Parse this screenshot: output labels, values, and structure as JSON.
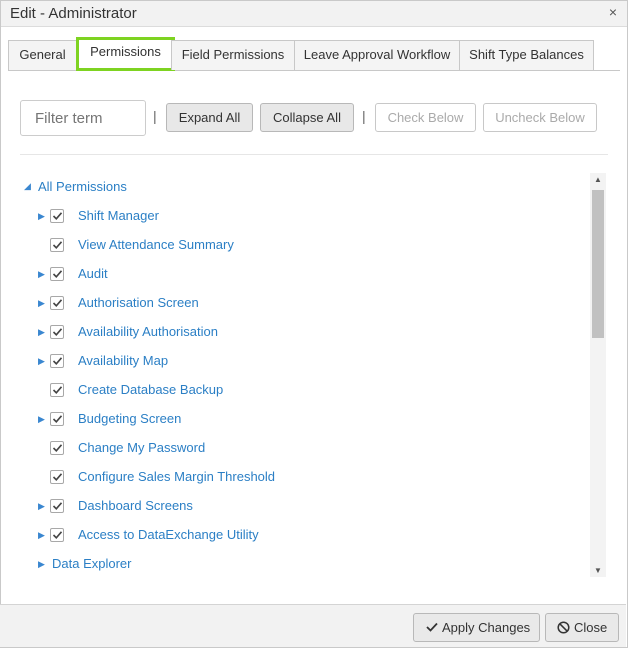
{
  "dialog": {
    "title": "Edit - Administrator",
    "close_symbol": "×"
  },
  "tabs": [
    {
      "label": "General"
    },
    {
      "label": "Permissions"
    },
    {
      "label": "Field Permissions"
    },
    {
      "label": "Leave Approval Workflow"
    },
    {
      "label": "Shift Type Balances"
    }
  ],
  "active_tab": "Permissions",
  "toolbar": {
    "filter_placeholder": "Filter term",
    "separator": "|",
    "expand_all": "Expand All",
    "collapse_all": "Collapse All",
    "check_below": "Check Below",
    "uncheck_below": "Uncheck Below"
  },
  "tree": {
    "root_label": "All Permissions",
    "items": [
      {
        "label": "Shift Manager",
        "expandable": true,
        "checked": true
      },
      {
        "label": "View Attendance Summary",
        "expandable": false,
        "checked": true
      },
      {
        "label": "Audit",
        "expandable": true,
        "checked": true
      },
      {
        "label": "Authorisation Screen",
        "expandable": true,
        "checked": true
      },
      {
        "label": "Availability Authorisation",
        "expandable": true,
        "checked": true
      },
      {
        "label": "Availability Map",
        "expandable": true,
        "checked": true
      },
      {
        "label": "Create Database Backup",
        "expandable": false,
        "checked": true
      },
      {
        "label": "Budgeting Screen",
        "expandable": true,
        "checked": true
      },
      {
        "label": "Change My Password",
        "expandable": false,
        "checked": true
      },
      {
        "label": "Configure Sales Margin Threshold",
        "expandable": false,
        "checked": true
      },
      {
        "label": "Dashboard Screens",
        "expandable": true,
        "checked": true
      },
      {
        "label": "Access to DataExchange Utility",
        "expandable": true,
        "checked": true
      },
      {
        "label": "Data Explorer",
        "expandable": true,
        "checked": false,
        "no_checkbox": true
      }
    ]
  },
  "footer": {
    "apply_label": "Apply Changes",
    "close_label": "Close"
  },
  "icons": {
    "expand": "triangle-right-icon",
    "collapse": "triangle-down-icon",
    "check": "checkmark-icon",
    "close": "ban-icon"
  },
  "colors": {
    "link": "#2b7fc5",
    "active_tab_border": "#7ed321"
  }
}
